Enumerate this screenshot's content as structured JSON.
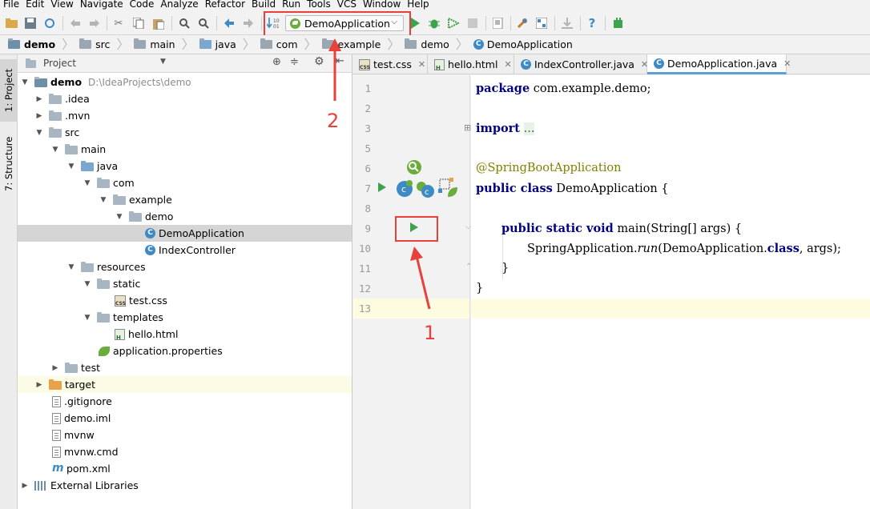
{
  "menu": [
    "File",
    "Edit",
    "View",
    "Navigate",
    "Code",
    "Analyze",
    "Refactor",
    "Build",
    "Run",
    "Tools",
    "VCS",
    "Window",
    "Help"
  ],
  "toolbar": {
    "run_config": "DemoApplication"
  },
  "breadcrumb": [
    "demo",
    "src",
    "main",
    "java",
    "com",
    "example",
    "demo",
    "DemoApplication"
  ],
  "left_tabs": {
    "project": "1: Project",
    "structure": "7: Structure"
  },
  "project_panel": {
    "title": "Project"
  },
  "tree": [
    {
      "label": "demo",
      "path": "D:\\IdeaProjects\\demo"
    },
    {
      "label": ".idea"
    },
    {
      "label": ".mvn"
    },
    {
      "label": "src"
    },
    {
      "label": "main"
    },
    {
      "label": "java"
    },
    {
      "label": "com"
    },
    {
      "label": "example"
    },
    {
      "label": "demo"
    },
    {
      "label": "DemoApplication"
    },
    {
      "label": "IndexController"
    },
    {
      "label": "resources"
    },
    {
      "label": "static"
    },
    {
      "label": "test.css"
    },
    {
      "label": "templates"
    },
    {
      "label": "hello.html"
    },
    {
      "label": "application.properties"
    },
    {
      "label": "test"
    },
    {
      "label": "target"
    },
    {
      "label": ".gitignore"
    },
    {
      "label": "demo.iml"
    },
    {
      "label": "mvnw"
    },
    {
      "label": "mvnw.cmd"
    },
    {
      "label": "pom.xml"
    },
    {
      "label": "External Libraries"
    }
  ],
  "tabs": [
    {
      "label": "test.css"
    },
    {
      "label": "hello.html"
    },
    {
      "label": "IndexController.java"
    },
    {
      "label": "DemoApplication.java"
    }
  ],
  "line_numbers": [
    "1",
    "2",
    "3",
    "5",
    "6",
    "7",
    "8",
    "9",
    "10",
    "11",
    "12",
    "13"
  ],
  "code": {
    "l1_kw": "package",
    "l1_rest": " com.example.demo;",
    "l3_kw": "import",
    "l3_fold": "...",
    "l6_ann": "@SpringBootApplication",
    "l7_kw": "public class",
    "l7_rest": " DemoApplication {",
    "l9_kw": "public static void",
    "l9_rest": " main(String[] args) {",
    "l10_a": "SpringApplication.",
    "l10_run": "run",
    "l10_b": "(DemoApplication.",
    "l10_cls": "class",
    "l10_c": ", args);",
    "l11": "}",
    "l12": "}"
  },
  "annotations": {
    "label1": "1",
    "label2": "2"
  }
}
